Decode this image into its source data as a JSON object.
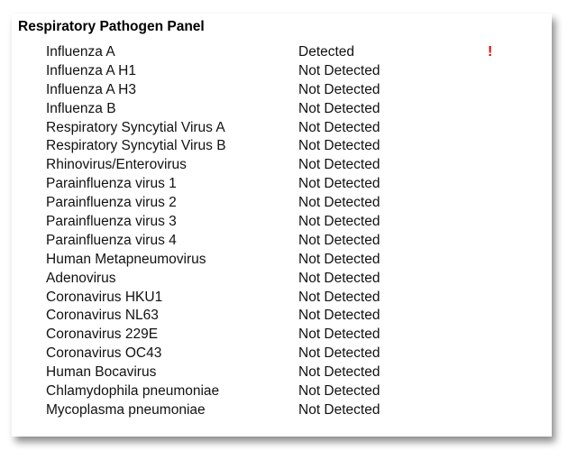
{
  "panel": {
    "title": "Respiratory Pathogen Panel",
    "flag_color": "#e00000",
    "rows": [
      {
        "name": "Influenza A",
        "result": "Detected",
        "flag": "!"
      },
      {
        "name": "Influenza A H1",
        "result": "Not Detected",
        "flag": ""
      },
      {
        "name": "Influenza A H3",
        "result": "Not Detected",
        "flag": ""
      },
      {
        "name": "Influenza B",
        "result": "Not Detected",
        "flag": ""
      },
      {
        "name": "Respiratory Syncytial Virus A",
        "result": "Not Detected",
        "flag": ""
      },
      {
        "name": "Respiratory Syncytial Virus B",
        "result": "Not Detected",
        "flag": ""
      },
      {
        "name": "Rhinovirus/Enterovirus",
        "result": "Not Detected",
        "flag": ""
      },
      {
        "name": "Parainfluenza virus 1",
        "result": "Not Detected",
        "flag": ""
      },
      {
        "name": "Parainfluenza virus 2",
        "result": "Not Detected",
        "flag": ""
      },
      {
        "name": "Parainfluenza virus 3",
        "result": "Not Detected",
        "flag": ""
      },
      {
        "name": "Parainfluenza virus 4",
        "result": "Not Detected",
        "flag": ""
      },
      {
        "name": "Human Metapneumovirus",
        "result": "Not Detected",
        "flag": ""
      },
      {
        "name": "Adenovirus",
        "result": "Not Detected",
        "flag": ""
      },
      {
        "name": "Coronavirus HKU1",
        "result": "Not Detected",
        "flag": ""
      },
      {
        "name": "Coronavirus NL63",
        "result": "Not Detected",
        "flag": ""
      },
      {
        "name": "Coronavirus 229E",
        "result": "Not Detected",
        "flag": ""
      },
      {
        "name": "Coronavirus OC43",
        "result": "Not Detected",
        "flag": ""
      },
      {
        "name": "Human Bocavirus",
        "result": "Not Detected",
        "flag": ""
      },
      {
        "name": "Chlamydophila pneumoniae",
        "result": "Not Detected",
        "flag": ""
      },
      {
        "name": "Mycoplasma pneumoniae",
        "result": "Not Detected",
        "flag": ""
      }
    ]
  }
}
